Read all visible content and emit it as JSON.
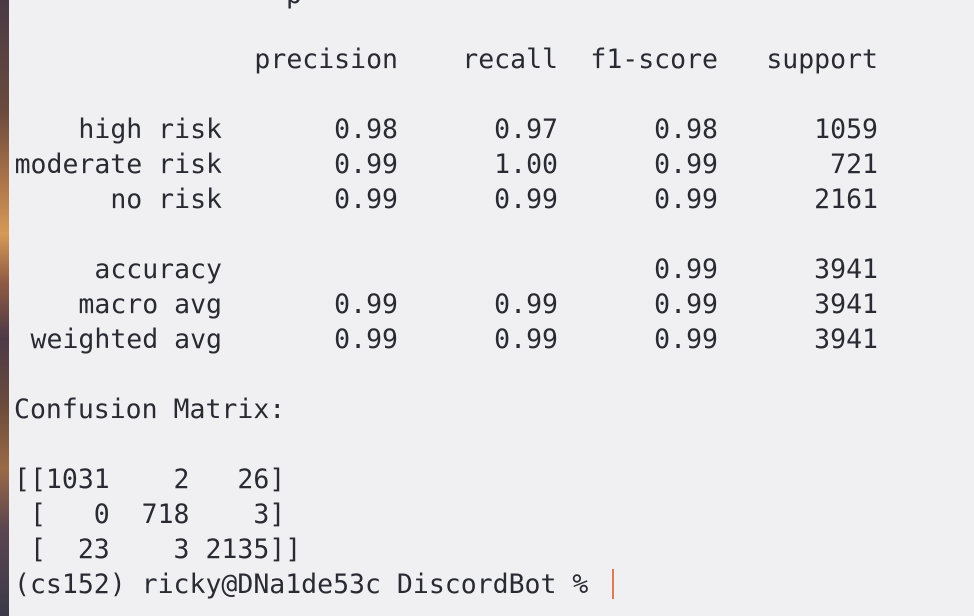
{
  "terminal": {
    "partial_top_text": "p",
    "report": {
      "headers": {
        "precision": "precision",
        "recall": "recall",
        "f1": "f1-score",
        "support": "support"
      },
      "rows": [
        {
          "label": "high risk",
          "precision": "0.98",
          "recall": "0.97",
          "f1": "0.98",
          "support": "1059"
        },
        {
          "label": "moderate risk",
          "precision": "0.99",
          "recall": "1.00",
          "f1": "0.99",
          "support": "721"
        },
        {
          "label": "no risk",
          "precision": "0.99",
          "recall": "0.99",
          "f1": "0.99",
          "support": "2161"
        }
      ],
      "accuracy": {
        "label": "accuracy",
        "f1": "0.99",
        "support": "3941"
      },
      "macro_avg": {
        "label": "macro avg",
        "precision": "0.99",
        "recall": "0.99",
        "f1": "0.99",
        "support": "3941"
      },
      "weighted_avg": {
        "label": "weighted avg",
        "precision": "0.99",
        "recall": "0.99",
        "f1": "0.99",
        "support": "3941"
      }
    },
    "confusion_title": "Confusion Matrix:",
    "matrix_lines": [
      "[[1031    2   26]",
      " [   0  718    3]",
      " [  23    3 2135]]"
    ],
    "prompt": "(cs152) ricky@DNa1de53c DiscordBot % "
  },
  "colors": {
    "background": "#f0f0f3",
    "text": "#2a2a33",
    "cursor": "#e07a57"
  }
}
